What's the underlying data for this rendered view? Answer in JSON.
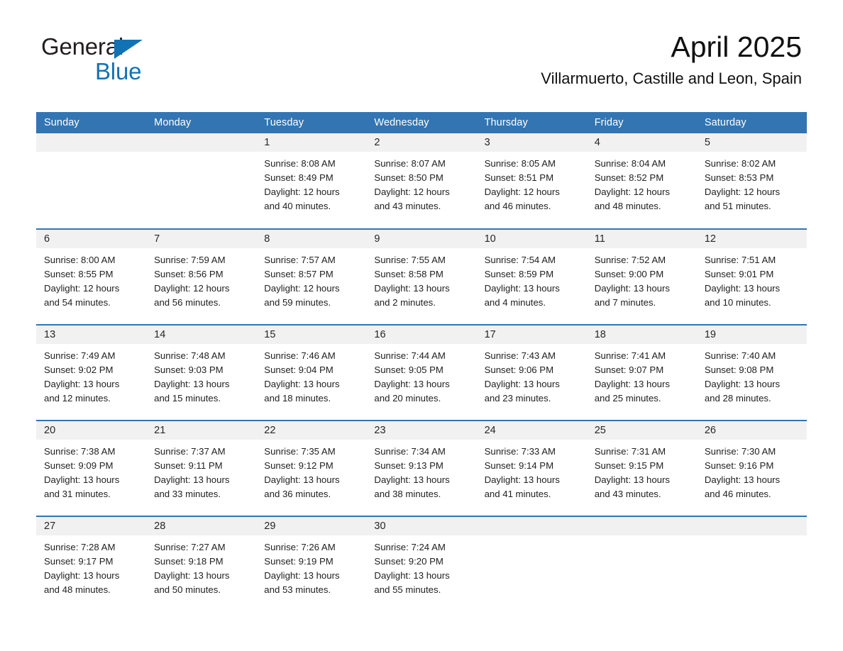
{
  "brand": {
    "name_part1": "General",
    "name_part2": "Blue",
    "triangle_icon": "triangle-icon",
    "color_black": "#231f20",
    "color_blue": "#1272b6"
  },
  "header": {
    "title": "April 2025",
    "subtitle": "Villarmuerto, Castille and Leon, Spain"
  },
  "theme": {
    "accent": "#3275b2",
    "daynum_bg": "#f1f1f1",
    "text": "#212121"
  },
  "calendar": {
    "weekday_headers": [
      "Sunday",
      "Monday",
      "Tuesday",
      "Wednesday",
      "Thursday",
      "Friday",
      "Saturday"
    ],
    "weeks": [
      [
        {
          "day": "",
          "sunrise": "",
          "sunset": "",
          "daylight_line1": "",
          "daylight_line2": "",
          "empty": true
        },
        {
          "day": "",
          "sunrise": "",
          "sunset": "",
          "daylight_line1": "",
          "daylight_line2": "",
          "empty": true
        },
        {
          "day": "1",
          "sunrise": "Sunrise: 8:08 AM",
          "sunset": "Sunset: 8:49 PM",
          "daylight_line1": "Daylight: 12 hours",
          "daylight_line2": "and 40 minutes."
        },
        {
          "day": "2",
          "sunrise": "Sunrise: 8:07 AM",
          "sunset": "Sunset: 8:50 PM",
          "daylight_line1": "Daylight: 12 hours",
          "daylight_line2": "and 43 minutes."
        },
        {
          "day": "3",
          "sunrise": "Sunrise: 8:05 AM",
          "sunset": "Sunset: 8:51 PM",
          "daylight_line1": "Daylight: 12 hours",
          "daylight_line2": "and 46 minutes."
        },
        {
          "day": "4",
          "sunrise": "Sunrise: 8:04 AM",
          "sunset": "Sunset: 8:52 PM",
          "daylight_line1": "Daylight: 12 hours",
          "daylight_line2": "and 48 minutes."
        },
        {
          "day": "5",
          "sunrise": "Sunrise: 8:02 AM",
          "sunset": "Sunset: 8:53 PM",
          "daylight_line1": "Daylight: 12 hours",
          "daylight_line2": "and 51 minutes."
        }
      ],
      [
        {
          "day": "6",
          "sunrise": "Sunrise: 8:00 AM",
          "sunset": "Sunset: 8:55 PM",
          "daylight_line1": "Daylight: 12 hours",
          "daylight_line2": "and 54 minutes."
        },
        {
          "day": "7",
          "sunrise": "Sunrise: 7:59 AM",
          "sunset": "Sunset: 8:56 PM",
          "daylight_line1": "Daylight: 12 hours",
          "daylight_line2": "and 56 minutes."
        },
        {
          "day": "8",
          "sunrise": "Sunrise: 7:57 AM",
          "sunset": "Sunset: 8:57 PM",
          "daylight_line1": "Daylight: 12 hours",
          "daylight_line2": "and 59 minutes."
        },
        {
          "day": "9",
          "sunrise": "Sunrise: 7:55 AM",
          "sunset": "Sunset: 8:58 PM",
          "daylight_line1": "Daylight: 13 hours",
          "daylight_line2": "and 2 minutes."
        },
        {
          "day": "10",
          "sunrise": "Sunrise: 7:54 AM",
          "sunset": "Sunset: 8:59 PM",
          "daylight_line1": "Daylight: 13 hours",
          "daylight_line2": "and 4 minutes."
        },
        {
          "day": "11",
          "sunrise": "Sunrise: 7:52 AM",
          "sunset": "Sunset: 9:00 PM",
          "daylight_line1": "Daylight: 13 hours",
          "daylight_line2": "and 7 minutes."
        },
        {
          "day": "12",
          "sunrise": "Sunrise: 7:51 AM",
          "sunset": "Sunset: 9:01 PM",
          "daylight_line1": "Daylight: 13 hours",
          "daylight_line2": "and 10 minutes."
        }
      ],
      [
        {
          "day": "13",
          "sunrise": "Sunrise: 7:49 AM",
          "sunset": "Sunset: 9:02 PM",
          "daylight_line1": "Daylight: 13 hours",
          "daylight_line2": "and 12 minutes."
        },
        {
          "day": "14",
          "sunrise": "Sunrise: 7:48 AM",
          "sunset": "Sunset: 9:03 PM",
          "daylight_line1": "Daylight: 13 hours",
          "daylight_line2": "and 15 minutes."
        },
        {
          "day": "15",
          "sunrise": "Sunrise: 7:46 AM",
          "sunset": "Sunset: 9:04 PM",
          "daylight_line1": "Daylight: 13 hours",
          "daylight_line2": "and 18 minutes."
        },
        {
          "day": "16",
          "sunrise": "Sunrise: 7:44 AM",
          "sunset": "Sunset: 9:05 PM",
          "daylight_line1": "Daylight: 13 hours",
          "daylight_line2": "and 20 minutes."
        },
        {
          "day": "17",
          "sunrise": "Sunrise: 7:43 AM",
          "sunset": "Sunset: 9:06 PM",
          "daylight_line1": "Daylight: 13 hours",
          "daylight_line2": "and 23 minutes."
        },
        {
          "day": "18",
          "sunrise": "Sunrise: 7:41 AM",
          "sunset": "Sunset: 9:07 PM",
          "daylight_line1": "Daylight: 13 hours",
          "daylight_line2": "and 25 minutes."
        },
        {
          "day": "19",
          "sunrise": "Sunrise: 7:40 AM",
          "sunset": "Sunset: 9:08 PM",
          "daylight_line1": "Daylight: 13 hours",
          "daylight_line2": "and 28 minutes."
        }
      ],
      [
        {
          "day": "20",
          "sunrise": "Sunrise: 7:38 AM",
          "sunset": "Sunset: 9:09 PM",
          "daylight_line1": "Daylight: 13 hours",
          "daylight_line2": "and 31 minutes."
        },
        {
          "day": "21",
          "sunrise": "Sunrise: 7:37 AM",
          "sunset": "Sunset: 9:11 PM",
          "daylight_line1": "Daylight: 13 hours",
          "daylight_line2": "and 33 minutes."
        },
        {
          "day": "22",
          "sunrise": "Sunrise: 7:35 AM",
          "sunset": "Sunset: 9:12 PM",
          "daylight_line1": "Daylight: 13 hours",
          "daylight_line2": "and 36 minutes."
        },
        {
          "day": "23",
          "sunrise": "Sunrise: 7:34 AM",
          "sunset": "Sunset: 9:13 PM",
          "daylight_line1": "Daylight: 13 hours",
          "daylight_line2": "and 38 minutes."
        },
        {
          "day": "24",
          "sunrise": "Sunrise: 7:33 AM",
          "sunset": "Sunset: 9:14 PM",
          "daylight_line1": "Daylight: 13 hours",
          "daylight_line2": "and 41 minutes."
        },
        {
          "day": "25",
          "sunrise": "Sunrise: 7:31 AM",
          "sunset": "Sunset: 9:15 PM",
          "daylight_line1": "Daylight: 13 hours",
          "daylight_line2": "and 43 minutes."
        },
        {
          "day": "26",
          "sunrise": "Sunrise: 7:30 AM",
          "sunset": "Sunset: 9:16 PM",
          "daylight_line1": "Daylight: 13 hours",
          "daylight_line2": "and 46 minutes."
        }
      ],
      [
        {
          "day": "27",
          "sunrise": "Sunrise: 7:28 AM",
          "sunset": "Sunset: 9:17 PM",
          "daylight_line1": "Daylight: 13 hours",
          "daylight_line2": "and 48 minutes."
        },
        {
          "day": "28",
          "sunrise": "Sunrise: 7:27 AM",
          "sunset": "Sunset: 9:18 PM",
          "daylight_line1": "Daylight: 13 hours",
          "daylight_line2": "and 50 minutes."
        },
        {
          "day": "29",
          "sunrise": "Sunrise: 7:26 AM",
          "sunset": "Sunset: 9:19 PM",
          "daylight_line1": "Daylight: 13 hours",
          "daylight_line2": "and 53 minutes."
        },
        {
          "day": "30",
          "sunrise": "Sunrise: 7:24 AM",
          "sunset": "Sunset: 9:20 PM",
          "daylight_line1": "Daylight: 13 hours",
          "daylight_line2": "and 55 minutes."
        },
        {
          "day": "",
          "sunrise": "",
          "sunset": "",
          "daylight_line1": "",
          "daylight_line2": "",
          "empty": true
        },
        {
          "day": "",
          "sunrise": "",
          "sunset": "",
          "daylight_line1": "",
          "daylight_line2": "",
          "empty": true
        },
        {
          "day": "",
          "sunrise": "",
          "sunset": "",
          "daylight_line1": "",
          "daylight_line2": "",
          "empty": true
        }
      ]
    ]
  }
}
